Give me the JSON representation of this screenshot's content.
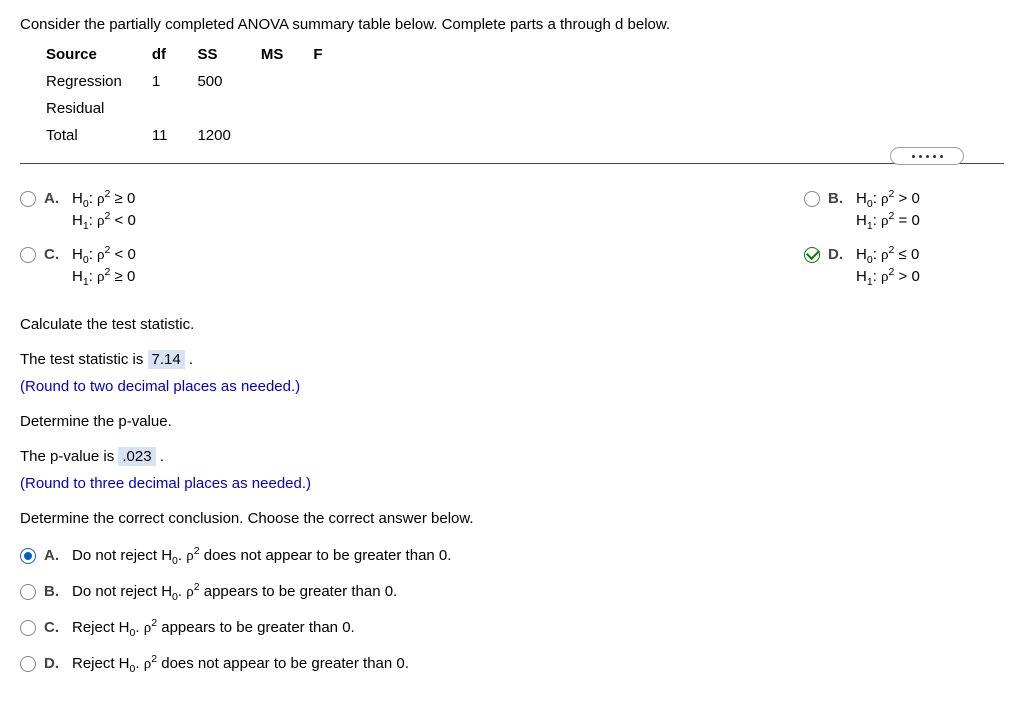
{
  "intro": "Consider the partially completed ANOVA summary table below. Complete parts a through d below.",
  "anova": {
    "headers": {
      "source": "Source",
      "df": "df",
      "ss": "SS",
      "ms": "MS",
      "f": "F"
    },
    "rows": {
      "regression": {
        "label": "Regression",
        "df": "1",
        "ss": "500"
      },
      "residual": {
        "label": "Residual"
      },
      "total": {
        "label": "Total",
        "df": "11",
        "ss": "1200"
      }
    }
  },
  "hyp": {
    "A": {
      "letter": "A.",
      "h0": "H",
      "h0sub": "0",
      "rho": "ρ",
      "sq": "2",
      "h0rel": " ≥ 0",
      "h1rel": " < 0"
    },
    "B": {
      "letter": "B.",
      "h0rel": " > 0",
      "h1rel": " = 0"
    },
    "C": {
      "letter": "C.",
      "h0rel": " < 0",
      "h1rel": " ≥ 0"
    },
    "D": {
      "letter": "D.",
      "h0rel": " ≤ 0",
      "h1rel": " > 0"
    }
  },
  "calc_stat_label": "Calculate the test statistic.",
  "stat_sentence_1": "The test statistic is ",
  "stat_value": "7.14",
  "stat_sentence_2": " .",
  "stat_hint": "(Round to two decimal places as needed.)",
  "pval_label": "Determine the p-value.",
  "pval_sentence_1": "The p-value is ",
  "pval_value": ".023",
  "pval_sentence_2": " .",
  "pval_hint": "(Round to three decimal places as needed.)",
  "concl_label": "Determine the correct conclusion. Choose the correct answer below.",
  "concl": {
    "A": {
      "letter": "A.",
      "pre": "Do not reject H",
      "post": " does not appear to be greater than 0."
    },
    "B": {
      "letter": "B.",
      "pre": "Do not reject H",
      "post": " appears to be greater than 0."
    },
    "C": {
      "letter": "C.",
      "pre": "Reject H",
      "post": " appears to be greater than 0."
    },
    "D": {
      "letter": "D.",
      "pre": "Reject H",
      "post": " does not appear to be greater than 0."
    }
  },
  "chart_data": {
    "type": "table",
    "title": "ANOVA summary table",
    "columns": [
      "Source",
      "df",
      "SS",
      "MS",
      "F"
    ],
    "rows": [
      [
        "Regression",
        1,
        500,
        null,
        null
      ],
      [
        "Residual",
        null,
        null,
        null,
        null
      ],
      [
        "Total",
        11,
        1200,
        null,
        null
      ]
    ]
  }
}
